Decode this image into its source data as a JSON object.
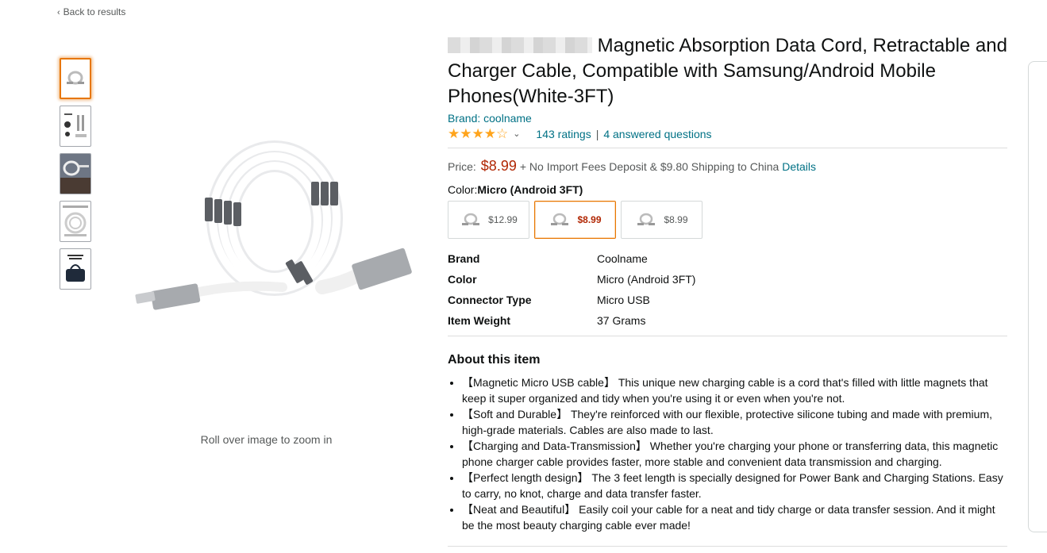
{
  "nav": {
    "back_label": "Back to results"
  },
  "gallery": {
    "thumbnails": [
      "cable-coil",
      "cable-parts",
      "cable-lifestyle",
      "cable-features",
      "cable-bag"
    ],
    "zoom_hint": "Roll over image to zoom in"
  },
  "product": {
    "title": "Magnetic Absorption Data Cord, Retractable and Charger Cable, Compatible with Samsung/Android Mobile Phones(White-3FT)",
    "brand_link": "Brand: coolname",
    "rating": 3.9,
    "stars_display": "★★★★☆",
    "ratings_count": "143 ratings",
    "answered_questions": "4 answered questions",
    "price_label": "Price:",
    "price": "$8.99",
    "shipping_text": "+ No Import Fees Deposit & $9.80 Shipping to China",
    "details_link": "Details",
    "color_label": "Color:",
    "color_value": "Micro (Android 3FT)",
    "swatches": [
      {
        "price": "$12.99",
        "selected": false
      },
      {
        "price": "$8.99",
        "selected": true
      },
      {
        "price": "$8.99",
        "selected": false
      }
    ],
    "specs": [
      {
        "key": "Brand",
        "value": "Coolname"
      },
      {
        "key": "Color",
        "value": "Micro (Android 3FT)"
      },
      {
        "key": "Connector Type",
        "value": "Micro USB"
      },
      {
        "key": "Item Weight",
        "value": "37 Grams"
      }
    ],
    "about_title": "About this item",
    "about_items": [
      "【Magnetic Micro USB cable】 This unique new charging cable is a cord that's filled with little magnets that keep it super organized and tidy when you're using it or even when you're not.",
      "【Soft and Durable】 They're reinforced with our flexible, protective silicone tubing and made with premium, high-grade materials. Cables are also made to last.",
      "【Charging and Data-Transmission】 Whether you're charging your phone or transferring data, this magnetic phone charger cable provides faster, more stable and convenient data transmission and charging.",
      "【Perfect length design】 The 3 feet length is specially designed for Power Bank and Charging Stations. Easy to carry, no knot, charge and data transfer faster.",
      "【Neat and Beautiful】 Easily coil your cable for a neat and tidy charge or data transfer session. And it might be the most beauty charging cable ever made!"
    ]
  },
  "colors": {
    "accent": "#e77600",
    "price": "#b12704",
    "link": "#007185",
    "star": "#ffa41c"
  }
}
